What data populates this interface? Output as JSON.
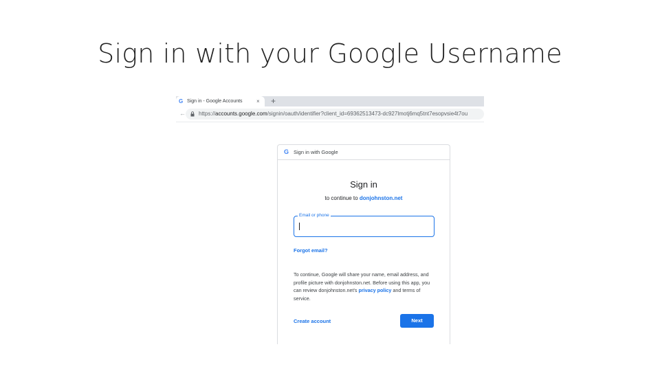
{
  "slide": {
    "title": "Sign in with your Google Username"
  },
  "browser": {
    "tab": {
      "favicon": "G",
      "title": "Sign in - Google Accounts",
      "close": "×"
    },
    "new_tab": "+",
    "url": {
      "scheme": "https://",
      "host": "accounts.google.com",
      "path": "/signin/oauth/identifier?client_id=69362513473-dc927lmotj6mq5tnt7esopvsie4t7ou"
    }
  },
  "card": {
    "header": {
      "icon": "G",
      "label": "Sign in with Google"
    },
    "title": "Sign in",
    "subtitle_prefix": "to continue to",
    "subtitle_link": "donjohnston.net",
    "email_field": {
      "label": "Email or phone",
      "value": ""
    },
    "forgot_email": "Forgot email?",
    "consent": {
      "text_before": "To continue, Google will share your name, email address, and profile picture with donjohnston.net. Before using this app, you can review donjohnston.net's ",
      "link": "privacy policy",
      "text_after": " and terms of service."
    },
    "create_account": "Create account",
    "next_label": "Next"
  },
  "colors": {
    "accent": "#1a73e8",
    "google_blue": "#4285f4",
    "tabstrip": "#dee1e6"
  }
}
